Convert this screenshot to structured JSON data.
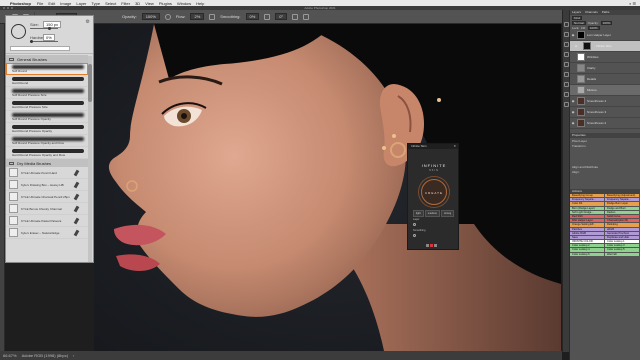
{
  "menubar": {
    "app": "Photoshop",
    "items": [
      "File",
      "Edit",
      "Image",
      "Layer",
      "Type",
      "Select",
      "Filter",
      "3D",
      "View",
      "Plugins",
      "Window",
      "Help"
    ],
    "right": "⌕ ☰"
  },
  "window_title": "Adobe Photoshop 2021",
  "options": {
    "mode_label": "Mode:",
    "mode_value": "Normal",
    "opacity_label": "Opacity:",
    "opacity_value": "100%",
    "flow_label": "Flow:",
    "flow_value": "2%",
    "smoothing_label": "Smoothing:",
    "smoothing_value": "0%",
    "angle_value": "0°"
  },
  "brush_panel": {
    "size_label": "Size:",
    "size_value": "150 px",
    "hardness_label": "Hardness:",
    "hardness_value": "0%",
    "general_group": "General Brushes",
    "brushes": [
      {
        "name": "Soft Round",
        "soft": true,
        "selected": true
      },
      {
        "name": "Hard Round",
        "soft": false
      },
      {
        "name": "Soft Round Pressure Size",
        "soft": true
      },
      {
        "name": "Hard Round Pressure Size",
        "soft": false
      },
      {
        "name": "Soft Round Pressure Opacity",
        "soft": true
      },
      {
        "name": "Hard Round Pressure Opacity",
        "soft": false
      },
      {
        "name": "Soft Round Pressure Opacity and Flow",
        "soft": true
      },
      {
        "name": "Hard Round Pressure Opacity and Flow",
        "soft": false
      }
    ],
    "dry_group": "Dry Media Brushes",
    "dry_brushes": [
      "KYLE Ultimate Pencil Hard",
      "Kyle's Drawing Box – Heavy HB",
      "KYLE Ultimate Charcoal Pencil 25px",
      "KYLE Bonus Chunky Charcoal",
      "KYLE Ultimate Pastel Palooza",
      "Kyle's Eraser – Natural Edge"
    ]
  },
  "status": {
    "zoom": "66.67%",
    "profile": "Adobe RGB (1998) (8bpc)",
    "arrow": "›"
  },
  "infinite_panel": {
    "title": "Infinite Skin",
    "close": "✕",
    "brand": "INFINITE",
    "sub": "SKIN",
    "create": "CREATE",
    "tabs": [
      "light",
      "medium",
      "strong"
    ],
    "label_1": "Layer",
    "label_2": "Smoothing"
  },
  "layers_panel": {
    "tabs": [
      "Layers",
      "Channels",
      "Paths"
    ],
    "kind": "Kind",
    "blend": "Normal",
    "opacity_label": "Opacity:",
    "opacity_value": "100%",
    "lock_label": "Lock:",
    "fill_label": "Fill:",
    "fill_value": "100%",
    "layers": [
      {
        "name": "Lum Helper Layer",
        "type": "mask"
      },
      {
        "name": "Infinite Skin",
        "type": "group"
      },
      {
        "name": "Wrinkles",
        "type": "white"
      },
      {
        "name": "Clarity",
        "type": "gray"
      },
      {
        "name": "Details",
        "type": "gray"
      },
      {
        "name": "Mixture",
        "type": "gray",
        "selected": true
      },
      {
        "name": "Smoothness 4",
        "type": "dark"
      },
      {
        "name": "Smoothness 3",
        "type": "dark"
      },
      {
        "name": "Smoothness 2",
        "type": "dark"
      }
    ]
  },
  "properties_panel": {
    "title": "Properties",
    "pixel_layer": "Pixel Layer",
    "transform": "Transform",
    "align": "Align and Distribute",
    "align_label": "Align:"
  },
  "actions_panel": {
    "title": "Actions",
    "rows": [
      {
        "left": "Beautifying Group",
        "right": "Beautifying (Adjustment)",
        "color": "#e6a04d"
      },
      {
        "left": "Frequency Separa...",
        "right": "Frequency Separa...",
        "color": "#b09ad6"
      },
      {
        "left": "Color Fill",
        "right": "Dodge Burn Layer",
        "color": "#e6a04d"
      },
      {
        "left": "Burn (Dodge Layer)",
        "right": "Dodge and Burn",
        "color": "#8fd18f"
      },
      {
        "left": "Soft Light Dodge...",
        "right": "Darken",
        "color": "#8fd18f"
      },
      {
        "left": "Red Shift",
        "right": "Solid Curve",
        "color": "#e06060"
      },
      {
        "left": "RAF Helper Layer",
        "right": "Channel(option B)",
        "color": "#e06060"
      },
      {
        "left": "Orange Setting Eff...",
        "right": "Relinking",
        "color": "#e6a04d"
      },
      {
        "left": "Paintbox",
        "right": "sRGB",
        "color": "#b09ad6"
      },
      {
        "left": "Adobe RGB",
        "right": "Generate Prochoro",
        "color": "#b09ad6"
      },
      {
        "left": "Save",
        "right": "Duplicate and Hide",
        "color": "#b09ad6"
      },
      {
        "left": "INFINITE COLOR",
        "right": "Color Lookup 1",
        "color": "#ffffff"
      },
      {
        "left": "Color Lookup 2",
        "right": "Color Lookup 3",
        "color": "#8fd18f"
      },
      {
        "left": "Color Lookup 4",
        "right": "Color Lookup 5",
        "color": "#8fd18f"
      },
      {
        "left": "Color Lookup 6",
        "right": "Warcraft",
        "color": "#8fd18f"
      }
    ]
  }
}
